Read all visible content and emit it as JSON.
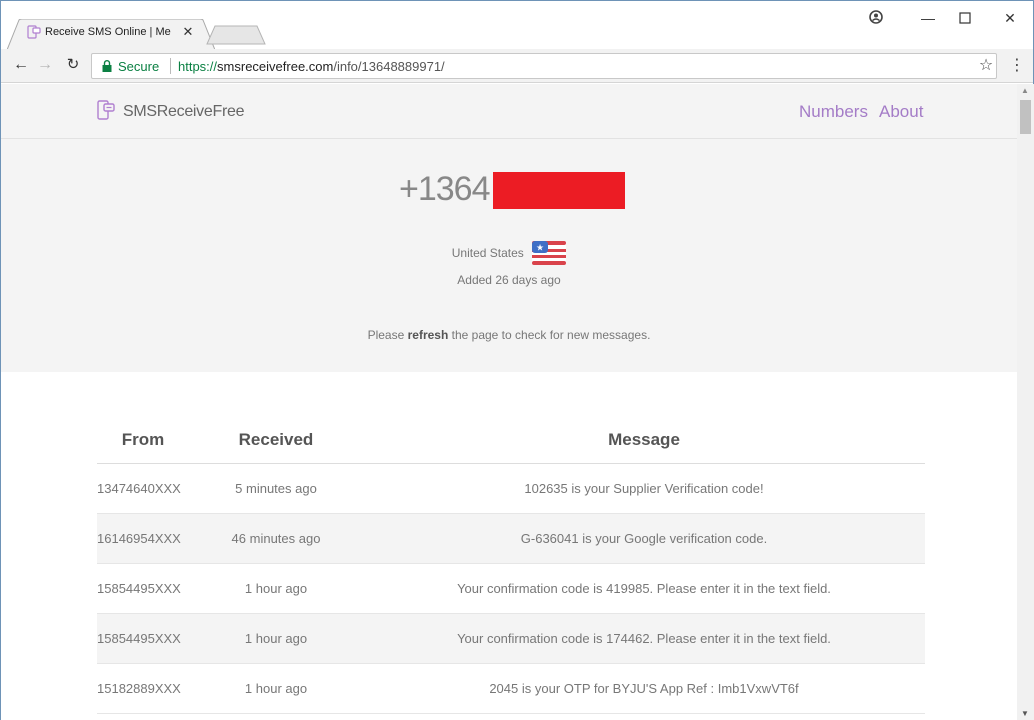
{
  "browser": {
    "tab_title": "Receive SMS Online | Me",
    "secure_label": "Secure",
    "url_scheme": "https://",
    "url_host": "smsreceivefree.com",
    "url_path": "/info/13648889971/"
  },
  "site": {
    "brand": "SMSReceiveFree",
    "nav": {
      "numbers": "Numbers",
      "about": "About"
    },
    "accent_color": "#a47cc7"
  },
  "number_info": {
    "phone_prefix": "+1364",
    "country": "United States",
    "added": "Added 26 days ago",
    "refresh_pre": "Please ",
    "refresh_bold": "refresh",
    "refresh_post": " the page to check for new messages."
  },
  "table": {
    "headers": {
      "from": "From",
      "received": "Received",
      "message": "Message"
    },
    "rows": [
      {
        "from": "13474640XXX",
        "received": "5 minutes ago",
        "message": "102635 is your Supplier Verification code!"
      },
      {
        "from": "16146954XXX",
        "received": "46 minutes ago",
        "message": "G-636041 is your Google verification code."
      },
      {
        "from": "15854495XXX",
        "received": "1 hour ago",
        "message": "Your confirmation code is 419985. Please enter it in the text field."
      },
      {
        "from": "15854495XXX",
        "received": "1 hour ago",
        "message": "Your confirmation code is 174462. Please enter it in the text field."
      },
      {
        "from": "15182889XXX",
        "received": "1 hour ago",
        "message": "2045 is your OTP for BYJU'S App Ref : Imb1VxwVT6f"
      }
    ]
  }
}
